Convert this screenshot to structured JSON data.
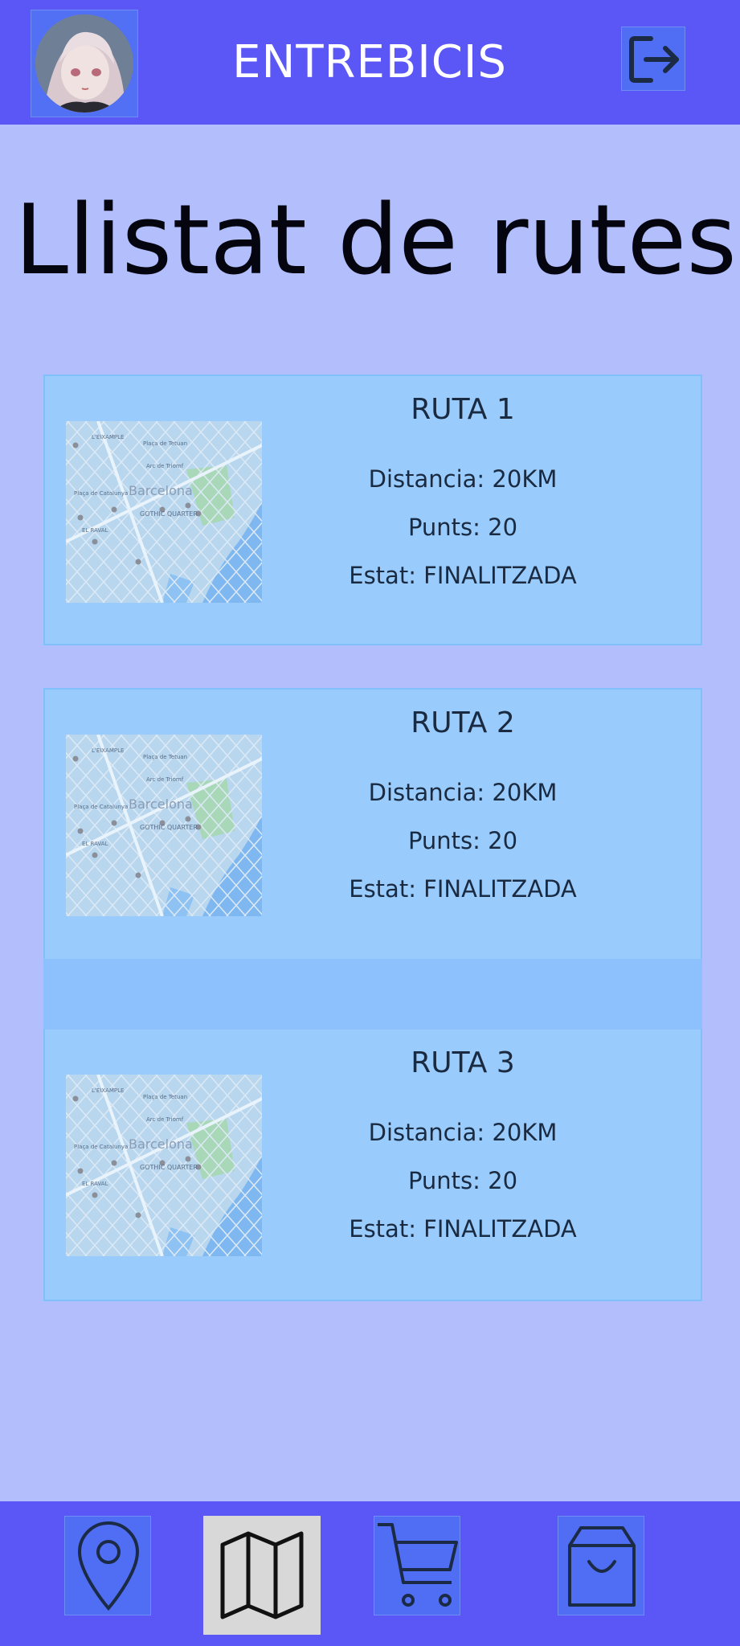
{
  "header": {
    "title": "ENTREBICIS",
    "avatar_icon": "user-avatar",
    "logout_icon": "logout-icon"
  },
  "page": {
    "title": "Llistat de rutes"
  },
  "routes": [
    {
      "name": "RUTA 1",
      "distance": "Distancia:  20KM",
      "points": "Punts: 20",
      "status": "Estat: FINALITZADA",
      "map_labels": [
        "Barcelona",
        "GOTHIC QUARTER",
        "EL RAVAL",
        "Plaça de Catalunya",
        "Arc de Triomf",
        "L'EIXAMPLE",
        "Plaça de Tetuan"
      ]
    },
    {
      "name": "RUTA 2",
      "distance": "Distancia:  20KM",
      "points": "Punts: 20",
      "status": "Estat: FINALITZADA",
      "map_labels": [
        "Barcelona",
        "GOTHIC QUARTER",
        "EL RAVAL",
        "Plaça de Catalunya",
        "Arc de Triomf",
        "L'EIXAMPLE",
        "Plaça de Tetuan"
      ]
    },
    {
      "name": "RUTA 3",
      "distance": "Distancia:  20KM",
      "points": "Punts: 20",
      "status": "Estat: FINALITZADA",
      "map_labels": [
        "Barcelona",
        "GOTHIC QUARTER",
        "EL RAVAL",
        "Plaça de Catalunya",
        "Arc de Triomf",
        "L'EIXAMPLE",
        "Plaça de Tetuan"
      ]
    }
  ],
  "bottom_nav": {
    "items": [
      {
        "icon": "location-pin-icon",
        "active": false
      },
      {
        "icon": "map-icon",
        "active": true
      },
      {
        "icon": "shopping-cart-icon",
        "active": false
      },
      {
        "icon": "shopping-bag-icon",
        "active": false
      }
    ]
  },
  "colors": {
    "bar": "#5b57f7",
    "background": "#b3bffd",
    "card": "#99cbfc",
    "icon_box": "#4f6ef3",
    "active_nav": "#d8d8d8"
  }
}
